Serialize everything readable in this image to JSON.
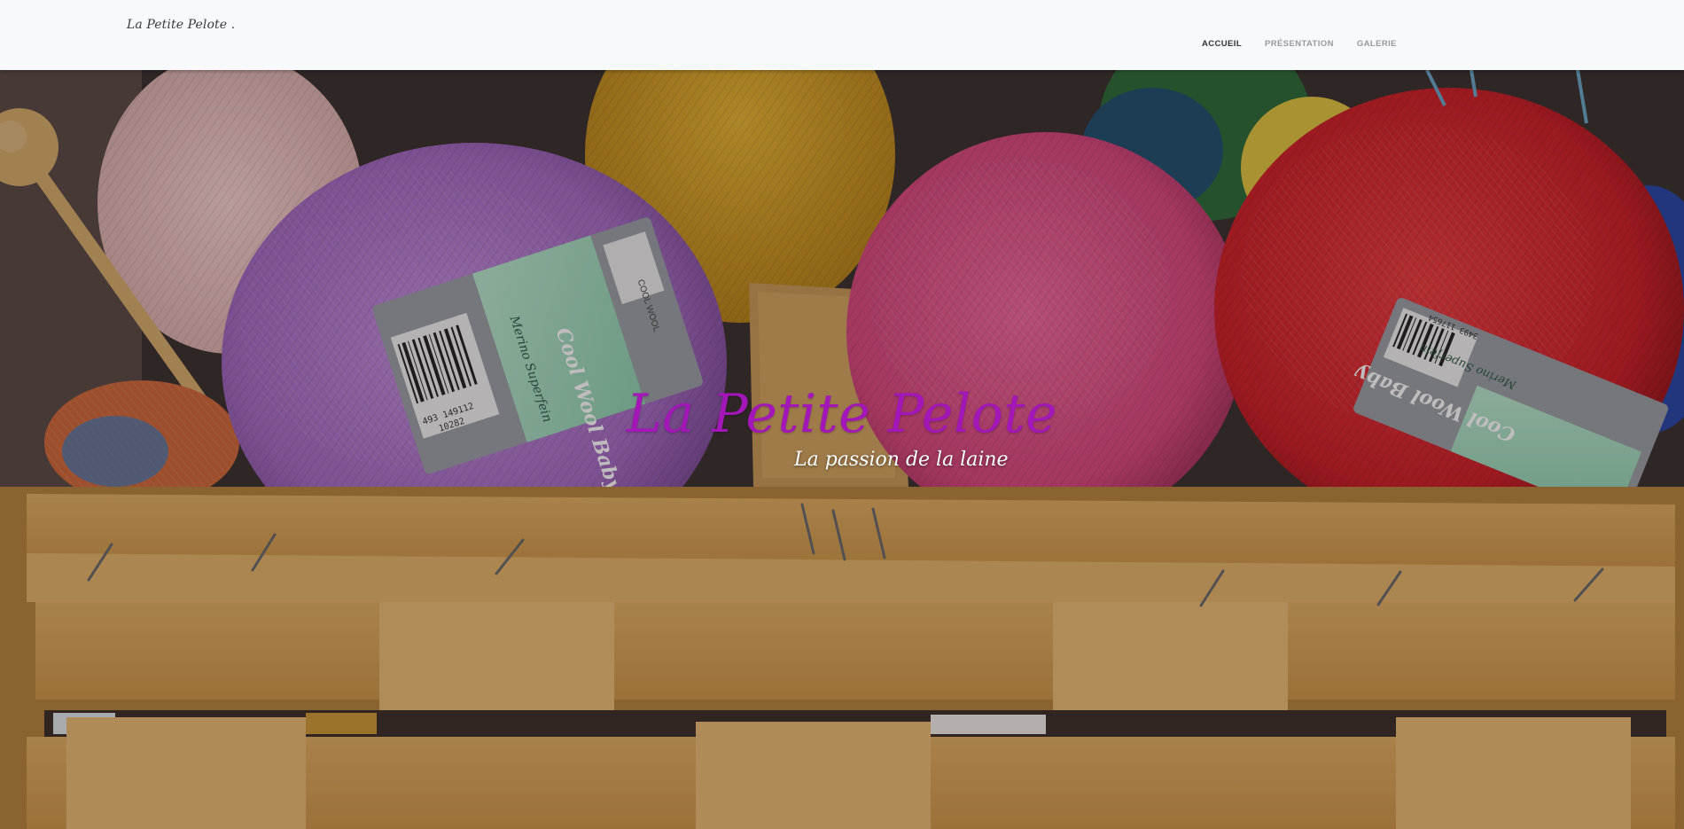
{
  "header": {
    "brand": "La Petite Pelote .",
    "nav": [
      {
        "label": "ACCUEIL",
        "active": true
      },
      {
        "label": "PRÉSENTATION",
        "active": false
      },
      {
        "label": "GALERIE",
        "active": false
      }
    ]
  },
  "hero": {
    "title": "La Petite Pelote",
    "subtitle": "La passion de la laine",
    "title_color": "#a317b8",
    "yarn_labels": {
      "brand_left": "COOL WOOL",
      "product": "Cool Wool Baby",
      "description": "Merino Superfein",
      "barcode_left": "493 149112",
      "lot_left": "10282",
      "barcode_right": "3493 117654"
    }
  },
  "colors": {
    "navbar_bg": "#f8f9fb",
    "nav_active": "#333333",
    "nav_inactive": "#9a9a9a",
    "yarn_purple": "#b87ad6",
    "yarn_yellow": "#d9a21e",
    "yarn_pink": "#e5508f",
    "yarn_red": "#d8242c",
    "basket": "#d9a357"
  },
  "icons": [
    "knitting-needle-icon"
  ]
}
